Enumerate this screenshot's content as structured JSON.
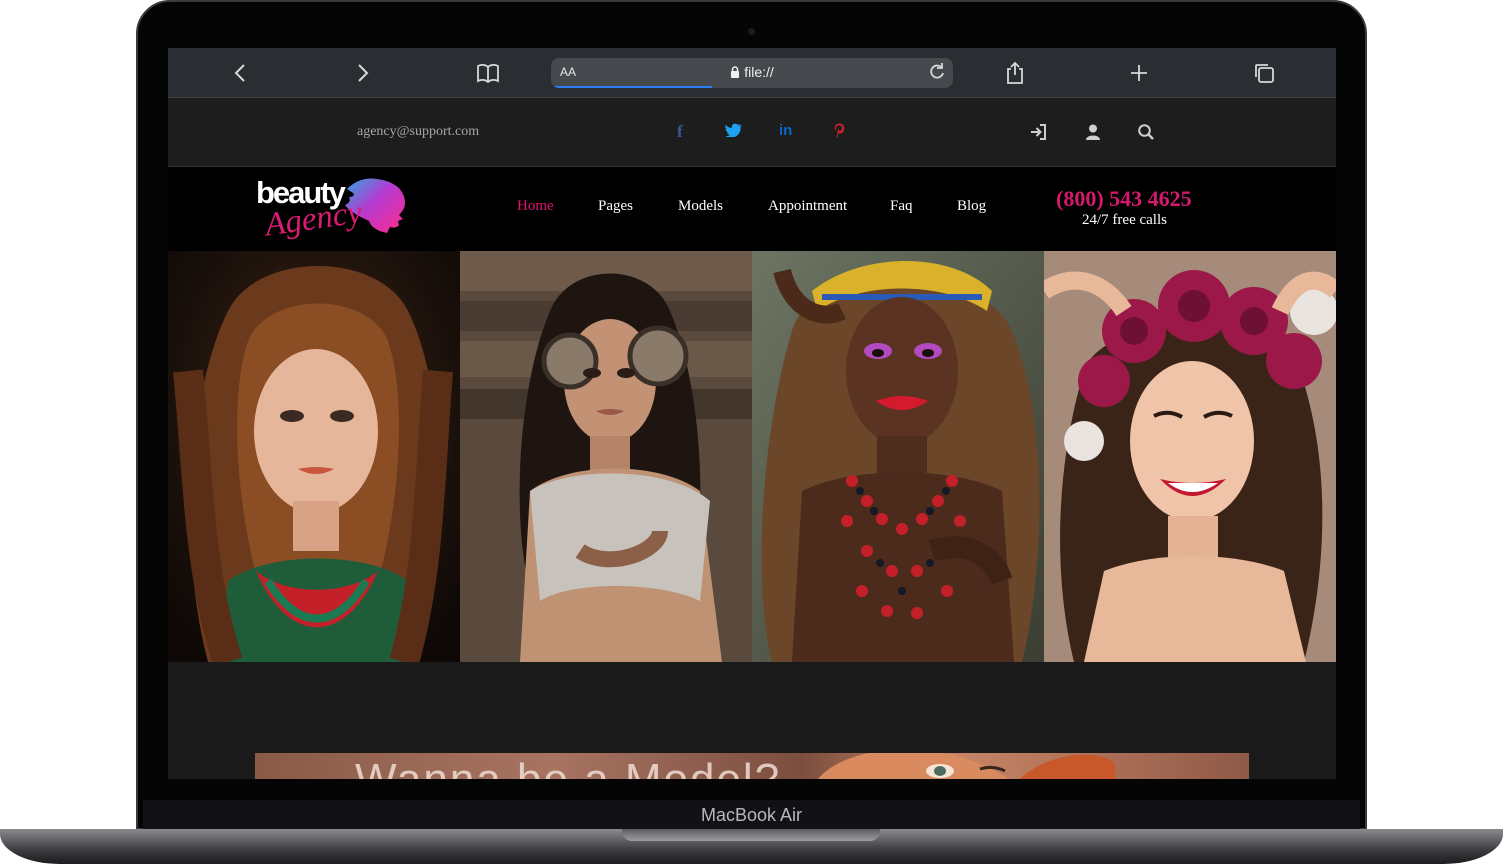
{
  "device": {
    "label": "MacBook Air"
  },
  "browser": {
    "address_small": "AA",
    "url": "file://",
    "icons": [
      "chevron-left-icon",
      "chevron-right-icon",
      "bookmarks-icon",
      "lock-icon",
      "reload-icon",
      "share-icon",
      "plus-icon",
      "tabs-icon"
    ]
  },
  "topbar": {
    "email": "agency@support.com",
    "social": [
      {
        "name": "facebook",
        "glyph": "f",
        "color": "#3b5998"
      },
      {
        "name": "twitter",
        "glyph": "t",
        "color": "#1da1f2"
      },
      {
        "name": "linkedin",
        "glyph": "in",
        "color": "#0a66c2"
      },
      {
        "name": "pinterest",
        "glyph": "p",
        "color": "#c8232c"
      }
    ],
    "tools": [
      "login-icon",
      "user-icon",
      "search-icon"
    ]
  },
  "logo": {
    "main": "beauty",
    "sub": "Agency"
  },
  "nav": {
    "items": [
      {
        "label": "Home",
        "active": true
      },
      {
        "label": "Pages",
        "active": false
      },
      {
        "label": "Models",
        "active": false
      },
      {
        "label": "Appointment",
        "active": false
      },
      {
        "label": "Faq",
        "active": false
      },
      {
        "label": "Blog",
        "active": false
      }
    ],
    "phone": "(800) 543 4625",
    "phone_note": "24/7 free calls"
  },
  "gallery": [
    {
      "name": "model-photo-1"
    },
    {
      "name": "model-photo-2"
    },
    {
      "name": "model-photo-3"
    },
    {
      "name": "model-photo-4"
    }
  ],
  "banner": {
    "text": "Wanna be a Model?"
  },
  "colors": {
    "accent": "#e0136f",
    "background": "#1a1a1a",
    "nav_bg": "#000000"
  }
}
